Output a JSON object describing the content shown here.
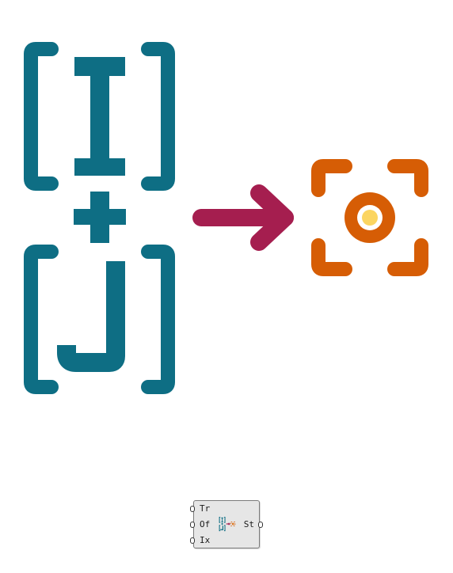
{
  "colors": {
    "teal": "#0e6e84",
    "crimson": "#a51e4f",
    "orange": "#d65d05",
    "yellow": "#fbd561",
    "component_fill": "#e6e6e6",
    "component_border": "#7a7a7a"
  },
  "icon": {
    "name": "index-pair-to-state-icon",
    "glyphs": {
      "top_letter": "I",
      "bottom_letter": "J",
      "operator": "+"
    }
  },
  "component": {
    "inputs": [
      {
        "label": "Tr"
      },
      {
        "label": "Of"
      },
      {
        "label": "Ix"
      }
    ],
    "outputs": [
      {
        "label": "St"
      }
    ]
  }
}
